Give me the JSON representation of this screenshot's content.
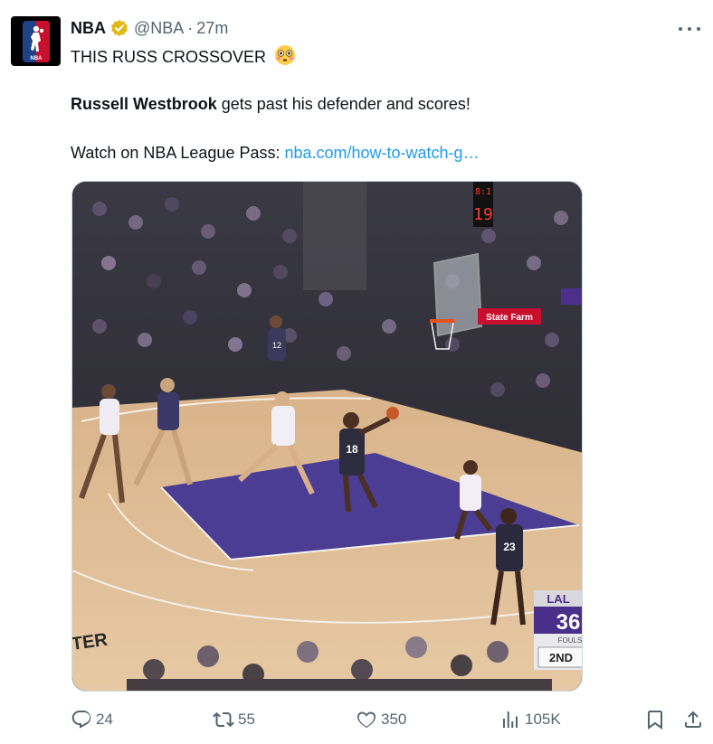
{
  "tweet": {
    "display_name": "NBA",
    "handle": "@NBA",
    "separator": "·",
    "time": "27m",
    "line1_text": "THIS RUSS CROSSOVER",
    "line1_emoji": "flushed-face-emoji",
    "line2_bold": "Russell Westbrook",
    "line2_rest": " gets past his defender and scores!",
    "line3_text": "Watch on NBA League Pass: ",
    "line3_link": "nba.com/how-to-watch-g…",
    "verified_color": "#e2b719",
    "link_color": "#1d9bf0"
  },
  "media": {
    "scoreboard_team": "LAL",
    "scoreboard_score": "36",
    "scoreboard_fouls_label": "FOULS",
    "scoreboard_period": "2ND",
    "shot_clock": "19",
    "game_clock": "8:1",
    "sponsor_banner": "State Farm",
    "floor_text": "TER",
    "jersey_1": "18",
    "jersey_2": "23",
    "jersey_3": "12"
  },
  "actions": {
    "replies": "24",
    "retweets": "55",
    "likes": "350",
    "views": "105K",
    "icons": [
      "reply-icon",
      "retweet-icon",
      "like-icon",
      "views-icon",
      "bookmark-icon",
      "share-icon"
    ]
  }
}
